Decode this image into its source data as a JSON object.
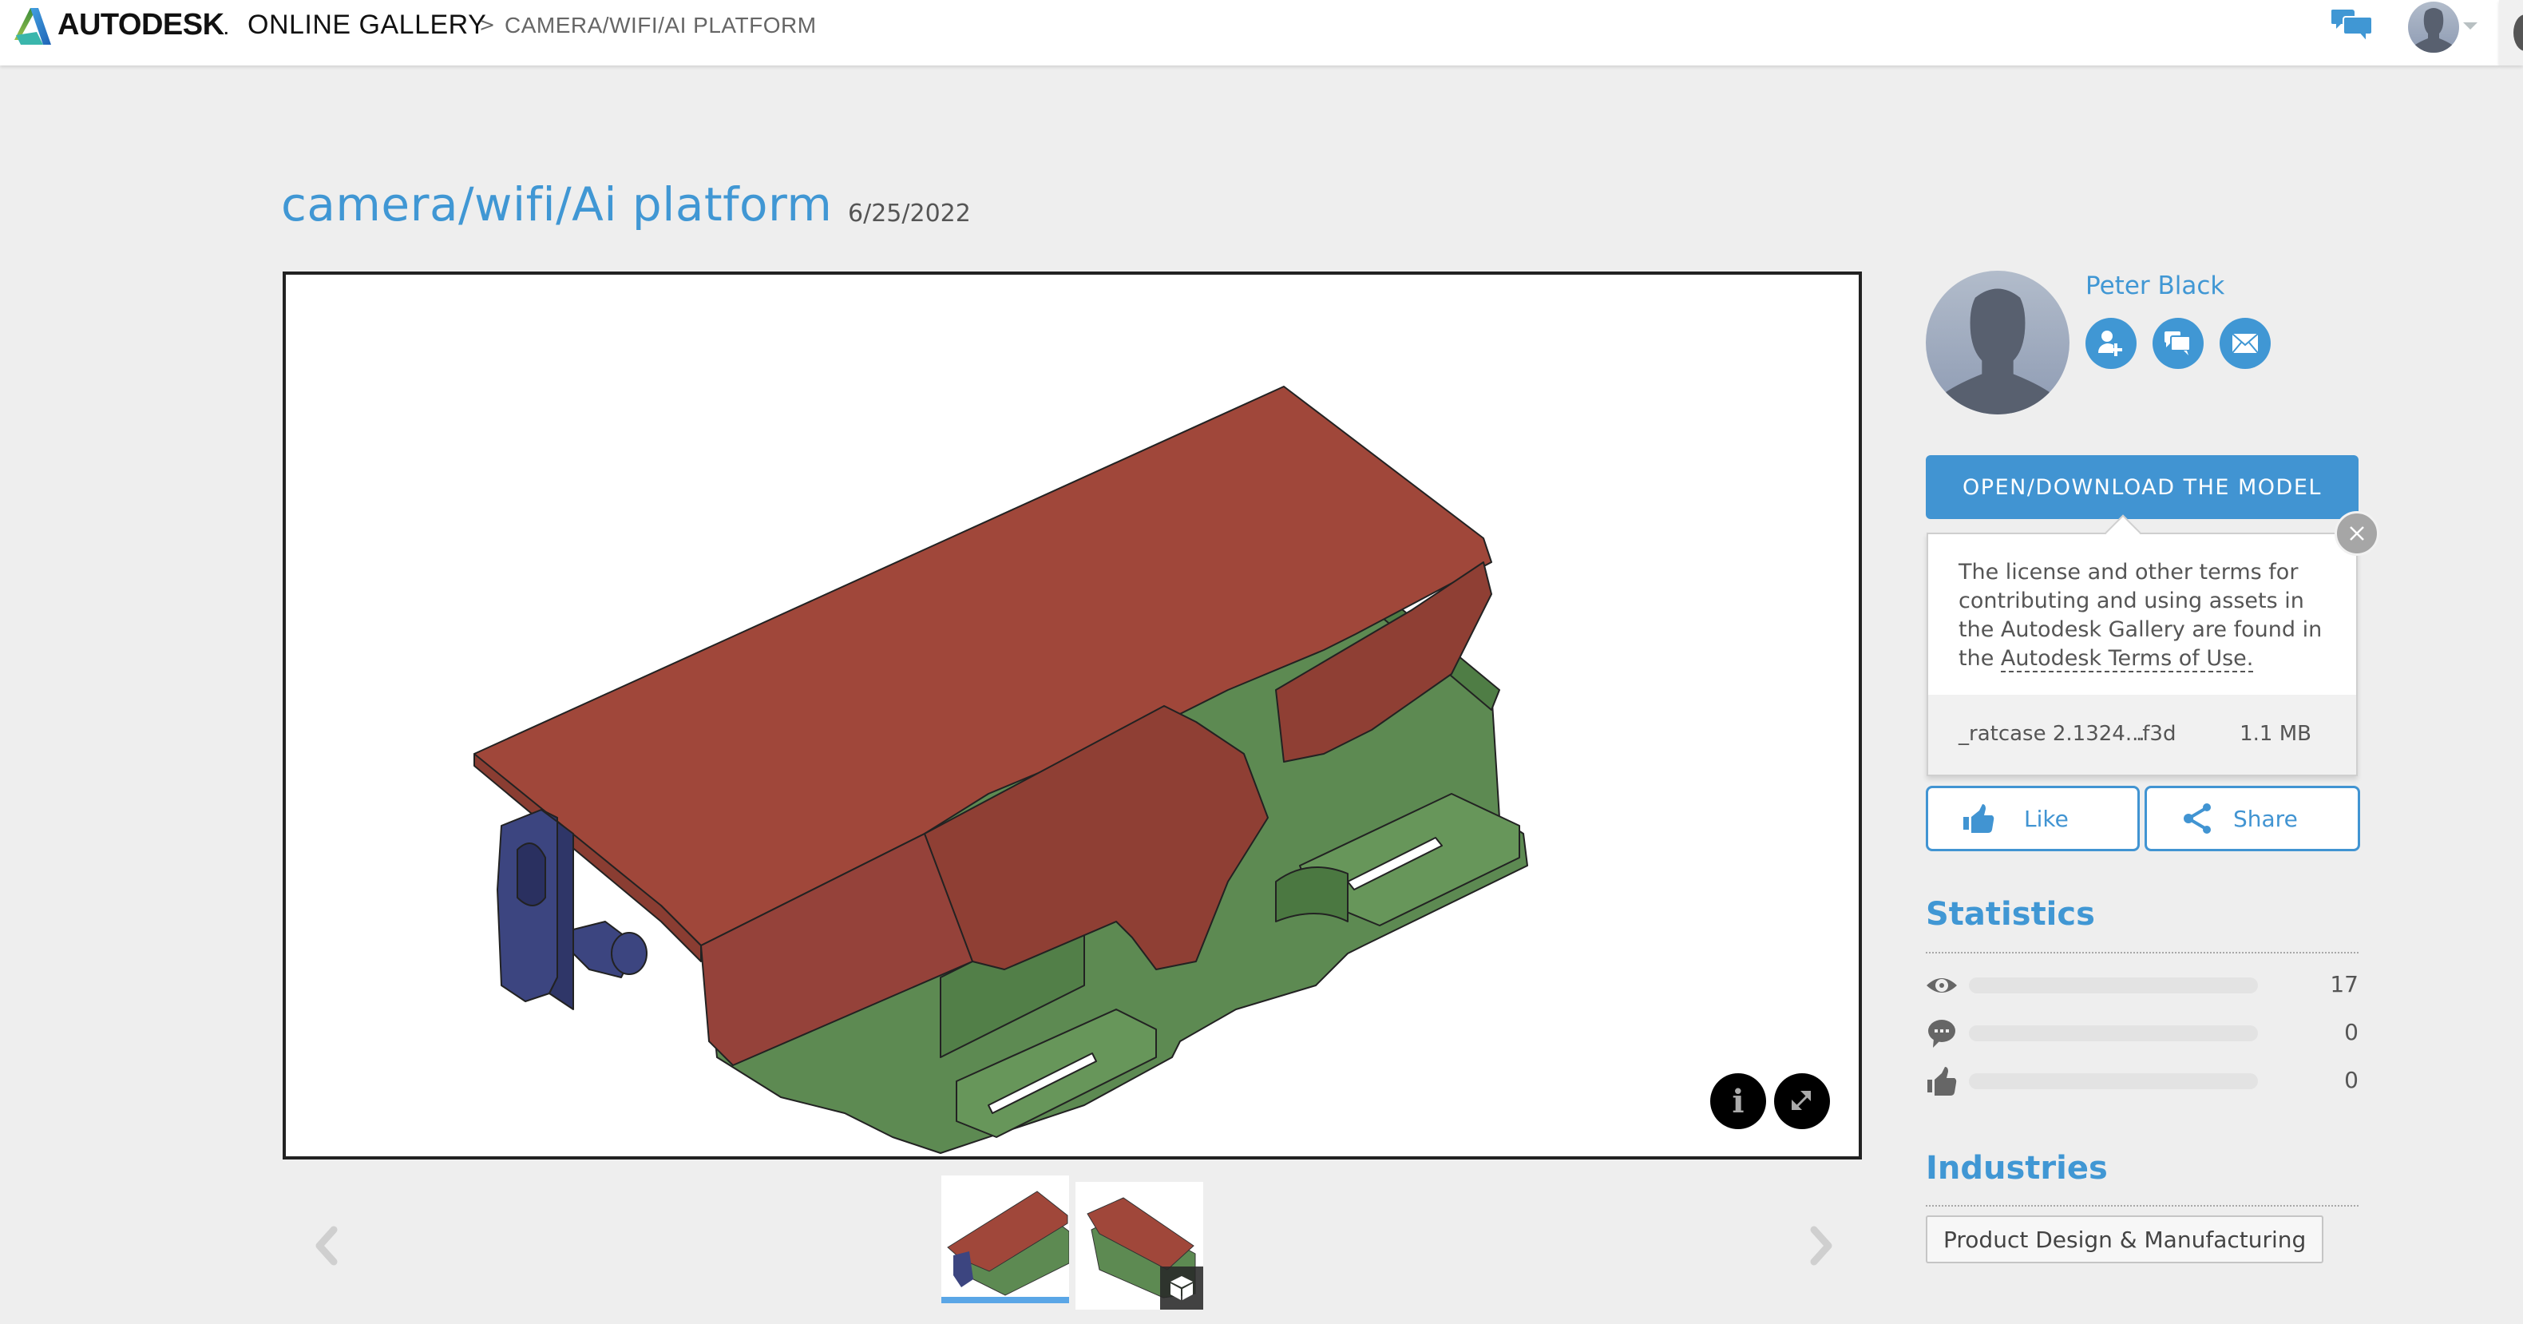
{
  "header": {
    "brand": "AUTODESK",
    "brand_suffix": ".",
    "product": "ONLINE GALLERY",
    "breadcrumb_separator": ">",
    "breadcrumb_current": "CAMERA/WIFI/AI PLATFORM",
    "icons": {
      "chat": "chat-bubbles-icon",
      "user": "user-avatar-icon",
      "menu": "caret-down-icon"
    }
  },
  "project": {
    "title": "camera/wifi/Ai platform",
    "date": "6/25/2022"
  },
  "viewer": {
    "info_button": "i",
    "fullscreen_icon": "expand-arrows-icon",
    "model_colors": {
      "lid": "#a0473a",
      "body": "#5a8a4e",
      "clip": "#3e4680"
    }
  },
  "thumbnails": {
    "items": [
      {
        "label": "Image 1",
        "selected": true
      },
      {
        "label": "3D model view",
        "selected": false,
        "badge": "3d-cube-icon"
      }
    ],
    "prev_icon": "chevron-left-icon",
    "next_icon": "chevron-right-icon"
  },
  "author": {
    "name": "Peter Black",
    "actions": [
      "follow-user-icon",
      "message-icon",
      "email-icon"
    ]
  },
  "download": {
    "button_label": "OPEN/DOWNLOAD THE MODEL",
    "terms_prefix": "The license and other terms for contributing and using assets in the Autodesk Gallery are found in the",
    "terms_link": "Autodesk Terms of Use.",
    "file": {
      "name": "_ratcase 2.1324...",
      "ext": ".f3d",
      "size": "1.1 MB"
    }
  },
  "actions": {
    "like_label": "Like",
    "share_label": "Share"
  },
  "statistics": {
    "heading": "Statistics",
    "rows": [
      {
        "icon": "eye-icon",
        "label": "Views",
        "value": "17",
        "fill": 0
      },
      {
        "icon": "comment-icon",
        "label": "Comments",
        "value": "0",
        "fill": 0
      },
      {
        "icon": "thumbs-up-icon",
        "label": "Likes",
        "value": "0",
        "fill": 0
      }
    ]
  },
  "industries": {
    "heading": "Industries",
    "tags": [
      "Product Design & Manufacturing"
    ]
  },
  "colors": {
    "accent": "#4097d4",
    "background": "#eeeeee",
    "button": "#4194d2"
  }
}
